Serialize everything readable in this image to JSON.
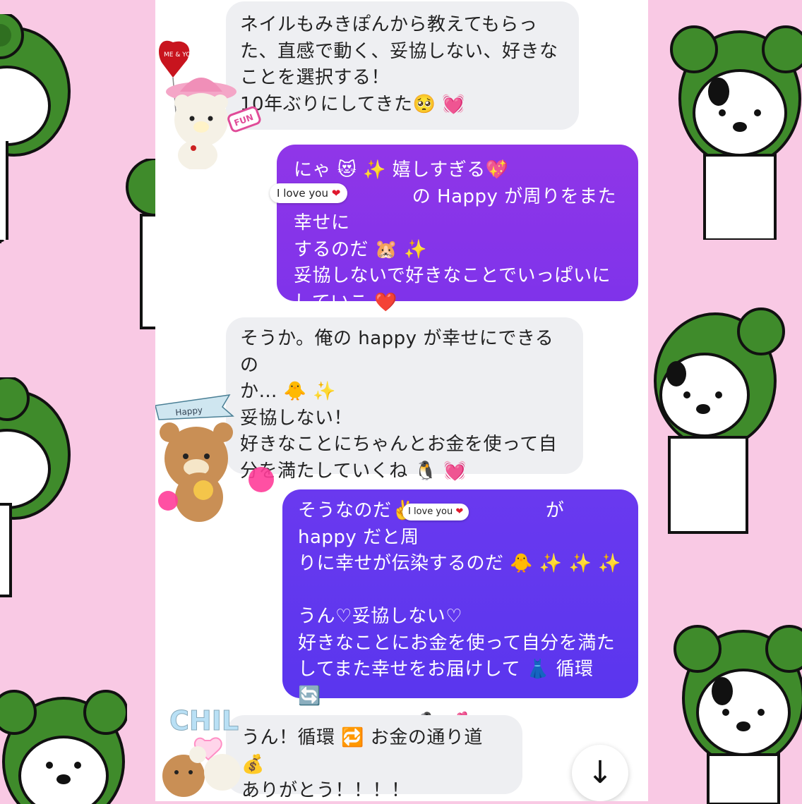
{
  "messages": [
    {
      "side": "incoming",
      "text": "ネイルもみきぽんから教えてもらっ\nた、直感で動く、妥協しない、好きな\nことを選択する！\n10年ぶりにしてきた🥺 💓"
    },
    {
      "side": "outgoing",
      "text": "にゃ 😻 ✨ 嬉しすぎる💖\n　　　　　　 の Happy が周りをまた幸せに\nするのだ 🐹 ✨\n妥協しないで好きなことでいっぱいに\nしていこ ❤️"
    },
    {
      "side": "incoming",
      "text": "そうか。俺の happy が幸せにできるの\nか… 🐥 ✨\n妥協しない！\n好きなことにちゃんとお金を使って自\n分を満たしていくね 🐧 💓"
    },
    {
      "side": "outgoing",
      "text": "そうなのだ✌️　　　　　　　が happy だと周\nりに幸せが伝染するのだ 🐥 ✨ ✨ ✨\n\nうん♡妥協しない♡\n好きなことにお金を使って自分を満た\nしてまた幸せをお届けして 👗 循環 🔄\nさせていこう 🐧 💕"
    },
    {
      "side": "incoming",
      "text": "うん！循環 🔁 お金の通り道 💰\nありがとう！！！！"
    }
  ],
  "reactions": {
    "ily1": "I love you",
    "ily2": "I love you",
    "heart": "❤"
  },
  "stickers": {
    "me_you": "ME & YOU",
    "fun": "FUN",
    "happy": "Happy",
    "chill": "CHILL"
  },
  "scroll_icon": "↓",
  "colors": {
    "outgoing_1": "#8b35e9",
    "outgoing_2": "#6338ef",
    "incoming": "#eeeff2",
    "page_bg": "#f9c9e4"
  }
}
